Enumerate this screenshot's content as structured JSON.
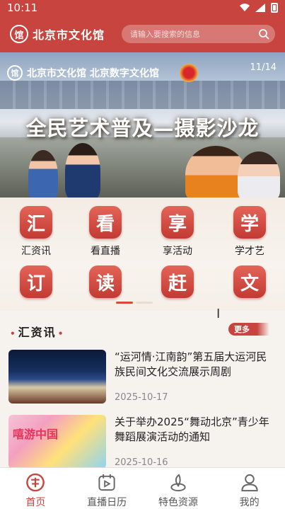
{
  "status_bar": {
    "time": "10:11"
  },
  "header": {
    "logo_text": "北京市文化馆",
    "logo_mark": "馆",
    "search_placeholder": "请输入要搜索的信息"
  },
  "banner": {
    "brand_text": "北京市文化馆 北京数字文化馆",
    "counter": "11/14",
    "title": "全民艺术普及—摄影沙龙"
  },
  "quick_grid": [
    {
      "glyph": "汇",
      "label": "汇资讯"
    },
    {
      "glyph": "看",
      "label": "看直播"
    },
    {
      "glyph": "享",
      "label": "享活动"
    },
    {
      "glyph": "学",
      "label": "学才艺"
    },
    {
      "glyph": "订",
      "label": ""
    },
    {
      "glyph": "读",
      "label": ""
    },
    {
      "glyph": "赶",
      "label": ""
    },
    {
      "glyph": "文",
      "label": ""
    }
  ],
  "news_section": {
    "title": "汇资讯",
    "more_label": "更多",
    "items": [
      {
        "title": "“运河情·江南韵”第五届大运河民族民间文化交流展示周剧",
        "date": "2025-10-17"
      },
      {
        "title": "关于举办2025“舞动北京”青少年舞蹈展演活动的通知",
        "date": "2025-10-16",
        "thumb_text": "嘻游中国"
      }
    ]
  },
  "bottom_nav": [
    {
      "label": "首页",
      "icon": "home-logo-icon",
      "active": true
    },
    {
      "label": "直播日历",
      "icon": "calendar-play-icon",
      "active": false
    },
    {
      "label": "特色资源",
      "icon": "leaf-resource-icon",
      "active": false
    },
    {
      "label": "我的",
      "icon": "person-icon",
      "active": false
    }
  ],
  "colors": {
    "brand": "#c8453f",
    "tile": "#d2483e",
    "text": "#222222",
    "muted": "#888888"
  }
}
